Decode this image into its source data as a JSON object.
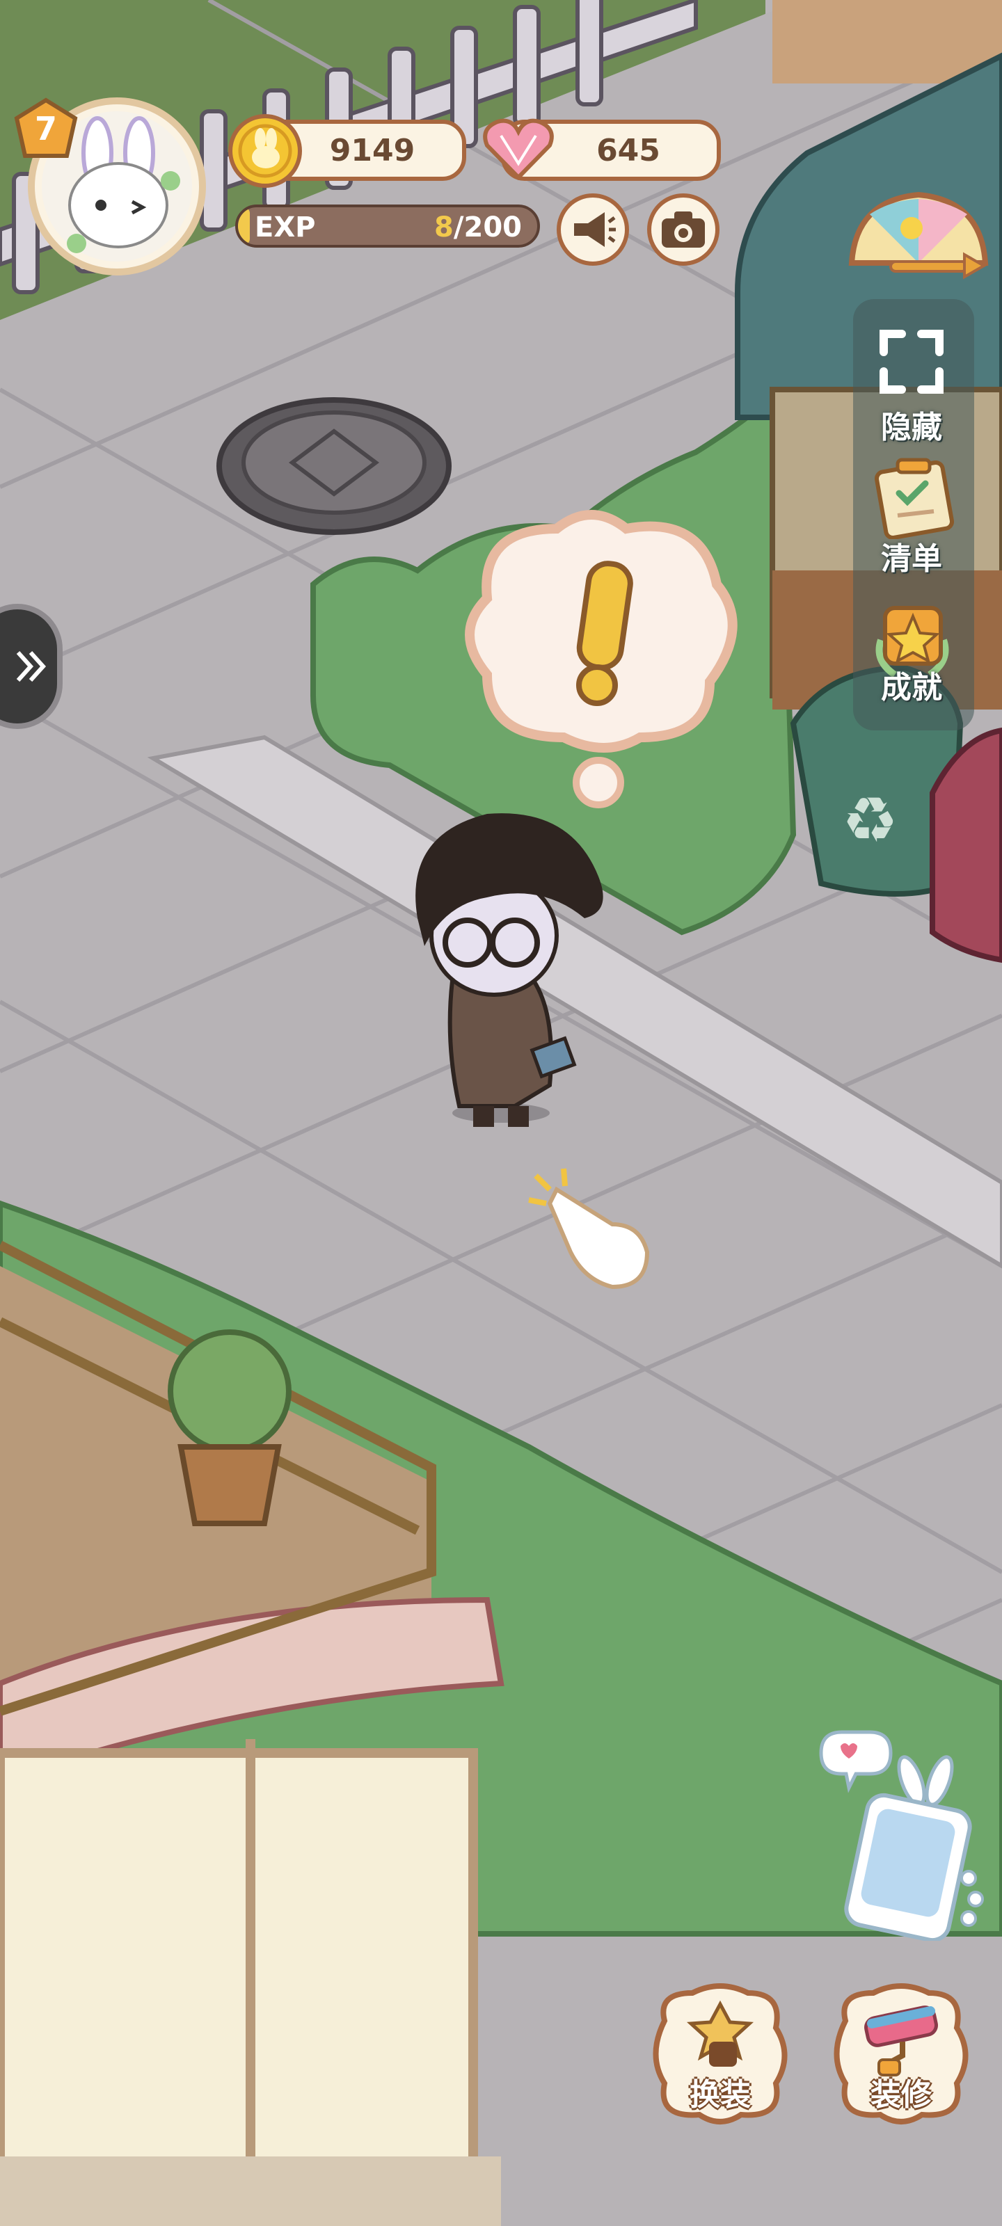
{
  "player": {
    "level": "7",
    "avatar_icon": "bunny-avatar-icon"
  },
  "currency": {
    "coins": "9149",
    "hearts": "645"
  },
  "exp": {
    "label": "EXP",
    "current": "8",
    "sep_max": "/200",
    "progress": 0.04
  },
  "side_menu": {
    "hide_label": "隐藏",
    "list_label": "清单",
    "achieve_label": "成就"
  },
  "bottom_menu": {
    "dress_label": "换装",
    "decor_label": "装修"
  },
  "colors": {
    "hud_border": "#a8673f",
    "hud_fill": "#fbf3e3",
    "exp_fill": "#f2c94c",
    "hedge": "#6ea66a"
  }
}
